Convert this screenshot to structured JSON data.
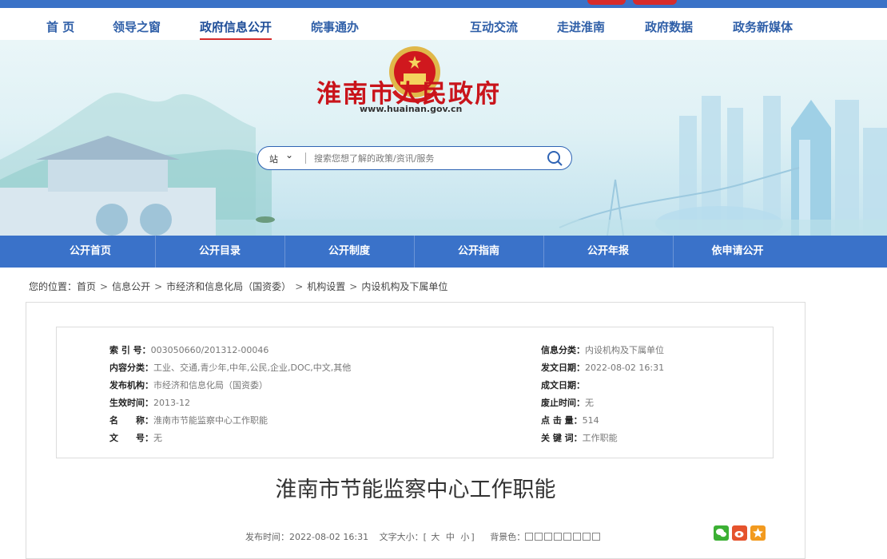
{
  "colors": {
    "brand_blue": "#3a72c9",
    "title_red": "#c9141b",
    "nav_text": "#2f5fa8"
  },
  "main_nav": [
    {
      "label": "首 页",
      "active": false
    },
    {
      "label": "领导之窗",
      "active": false
    },
    {
      "label": "政府信息公开",
      "active": true
    },
    {
      "label": "皖事通办",
      "active": false
    },
    {
      "label": "互动交流",
      "active": false
    },
    {
      "label": "走进淮南",
      "active": false
    },
    {
      "label": "政府数据",
      "active": false
    },
    {
      "label": "政务新媒体",
      "active": false
    }
  ],
  "banner": {
    "site_title": "淮南市人民政府",
    "site_url": "www.huainan.gov.cn",
    "emblem_icon": "national-emblem-icon"
  },
  "search": {
    "scope": "站",
    "placeholder": "搜索您想了解的政策/资讯/服务",
    "icon": "search-icon"
  },
  "sub_nav": [
    "公开首页",
    "公开目录",
    "公开制度",
    "公开指南",
    "公开年报",
    "依申请公开"
  ],
  "breadcrumb": {
    "prefix": "您的位置：",
    "items": [
      "首页",
      "信息公开",
      "市经济和信息化局（国资委）",
      "机构设置",
      "内设机构及下属单位"
    ],
    "separator": ">"
  },
  "meta": {
    "left": [
      {
        "key": "索 引 号：",
        "value": "003050660/201312-00046"
      },
      {
        "key": "内容分类：",
        "value": "工业、交通,青少年,中年,公民,企业,DOC,中文,其他"
      },
      {
        "key": "发布机构：",
        "value": "市经济和信息化局（国资委）"
      },
      {
        "key": "生效时间：",
        "value": "2013-12"
      },
      {
        "key": "名　　称：",
        "value": "淮南市节能监察中心工作职能"
      },
      {
        "key": "文　　号：",
        "value": "无"
      }
    ],
    "right": [
      {
        "key": "信息分类：",
        "value": "内设机构及下属单位"
      },
      {
        "key": "发文日期：",
        "value": "2022-08-02 16:31"
      },
      {
        "key": "成文日期：",
        "value": ""
      },
      {
        "key": "废止时间：",
        "value": "无"
      },
      {
        "key": "点 击 量：",
        "value": "514"
      },
      {
        "key": "关 键 词：",
        "value": "工作职能"
      }
    ]
  },
  "article": {
    "title": "淮南市节能监察中心工作职能",
    "publish_label": "发布时间：",
    "publish_time": "2022-08-02 16:31",
    "font_size_label": "文字大小：",
    "font_size_options": [
      "大",
      "中",
      "小"
    ],
    "bg_label": "背景色："
  },
  "share_icons": [
    "wechat-icon",
    "weibo-icon",
    "favorite-icon"
  ]
}
